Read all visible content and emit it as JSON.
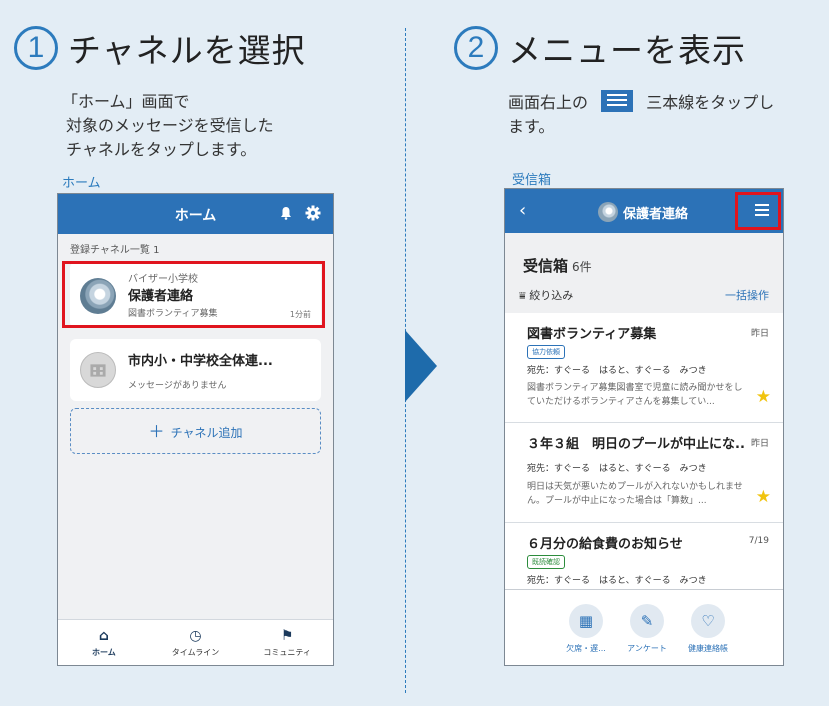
{
  "step1": {
    "number": "1",
    "title": "チャネルを選択",
    "desc_line1": "「ホーム」画面で",
    "desc_line2": "対象のメッセージを受信した",
    "desc_line3": "チャネルをタップします。",
    "screen_label": "ホーム"
  },
  "step2": {
    "number": "2",
    "title": "メニューを表示",
    "desc_line1a": "画面右上の",
    "desc_line1b": "三本線をタップし",
    "desc_line2": "ます。",
    "screen_label": "受信箱"
  },
  "phone1": {
    "app_title": "ホーム",
    "section_label": "登録チャネル一覧 1",
    "channels": [
      {
        "sub": "バイザー小学校",
        "name": "保護者連絡",
        "message": "図書ボランティア募集",
        "time": "1分前"
      },
      {
        "name": "市内小・中学校全体連...",
        "message": "メッセージがありません"
      }
    ],
    "add_channel": "チャネル追加",
    "tabs": [
      {
        "label": "ホーム",
        "icon": "home-icon"
      },
      {
        "label": "タイムライン",
        "icon": "clock-icon"
      },
      {
        "label": "コミュニティ",
        "icon": "community-icon"
      }
    ]
  },
  "phone2": {
    "app_title": "保護者連絡",
    "inbox_title": "受信箱",
    "inbox_count": "6件",
    "filter": "絞り込み",
    "bulk": "一括操作",
    "messages": [
      {
        "title": "図書ボランティア募集",
        "date": "昨日",
        "tag": "協力依頼",
        "to": "宛先：すぐーる　はると、すぐーる　みつき",
        "body": "図書ボランティア募集図書室で児童に読み聞かせをしていただけるボランティアさんを募集してい...",
        "starred": true
      },
      {
        "title": "３年３組　明日のプールが中止にな...",
        "date": "昨日",
        "to": "宛先：すぐーる　はると、すぐーる　みつき",
        "body": "明日は天気が悪いためプールが入れないかもしれません。プールが中止になった場合は「算数」...",
        "starred": true
      },
      {
        "title": "６月分の給食費のお知らせ",
        "date": "7/19",
        "tag": "既読確認",
        "to": "宛先：すぐーる　はると、すぐーる　みつき"
      }
    ],
    "actions": [
      {
        "label": "欠席・遅...",
        "icon": "calendar-icon"
      },
      {
        "label": "アンケート",
        "icon": "survey-icon"
      },
      {
        "label": "健康連絡帳",
        "icon": "health-icon"
      }
    ]
  },
  "colors": {
    "accent": "#2c72b7",
    "highlight": "#e0141e",
    "background": "#e3edf5"
  }
}
